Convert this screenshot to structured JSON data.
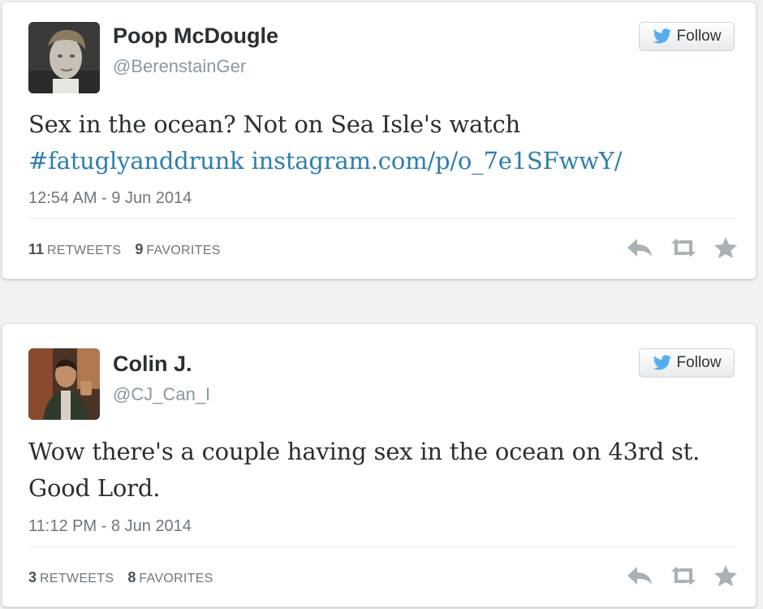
{
  "tweets": [
    {
      "name": "Poop McDougle",
      "handle": "@BerenstainGer",
      "follow_label": "Follow",
      "text_plain": "Sex in the ocean? Not on Sea Isle's watch",
      "hashtag": "#fatuglyanddrunk",
      "link": "instagram.com/p/o_7e1SFwwY/",
      "timestamp": "12:54 AM - 9 Jun 2014",
      "retweets_count": "11",
      "retweets_label": "RETWEETS",
      "favorites_count": "9",
      "favorites_label": "FAVORITES"
    },
    {
      "name": "Colin J.",
      "handle": "@CJ_Can_I",
      "follow_label": "Follow",
      "text_plain": "Wow there's a couple having sex in the ocean on 43rd st. Good Lord.",
      "timestamp": "11:12 PM - 8 Jun 2014",
      "retweets_count": "3",
      "retweets_label": "RETWEETS",
      "favorites_count": "8",
      "favorites_label": "FAVORITES"
    }
  ],
  "icons": {
    "bird": "twitter-bird-icon",
    "reply": "reply-icon",
    "retweet": "retweet-icon",
    "favorite": "star-icon"
  },
  "colors": {
    "link": "#2e7fae",
    "bird": "#55acee",
    "action_icon": "#a9b1b6"
  }
}
